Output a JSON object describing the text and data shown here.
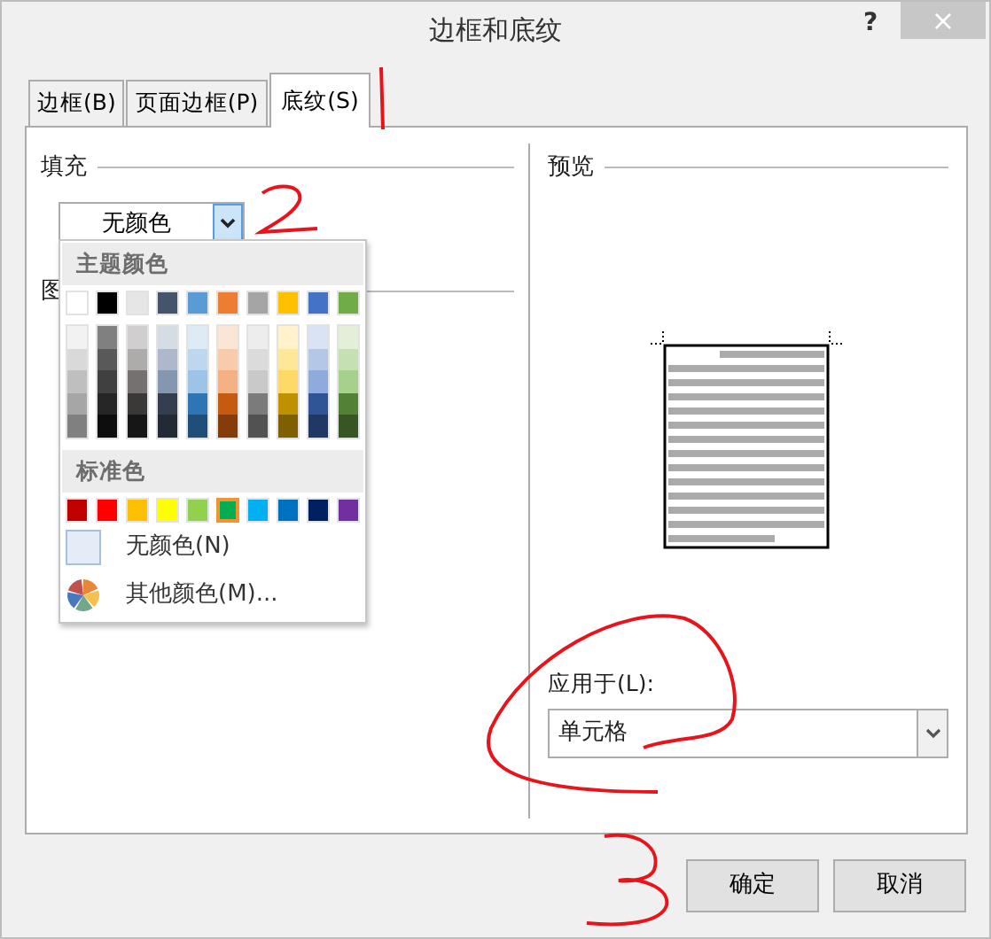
{
  "window": {
    "title": "边框和底纹",
    "help": "?",
    "close": "×"
  },
  "tabs": [
    {
      "label": "边框(B)",
      "selected": false
    },
    {
      "label": "页面边框(P)",
      "selected": false
    },
    {
      "label": "底纹(S)",
      "selected": true
    }
  ],
  "fill": {
    "label": "填充",
    "dropdown": {
      "value": "无颜色",
      "expanded": true
    }
  },
  "pattern": {
    "label": "图"
  },
  "color_menu": {
    "theme_header": "主题颜色",
    "theme_colors": [
      {
        "color": "#ffffff",
        "shades": [
          {
            "color": "#f2f2f2"
          },
          {
            "color": "#d9d9d9"
          },
          {
            "color": "#bfbfbf"
          },
          {
            "color": "#a6a6a6"
          },
          {
            "color": "#808080"
          }
        ]
      },
      {
        "color": "#000000",
        "shades": [
          {
            "color": "#808080"
          },
          {
            "color": "#595959"
          },
          {
            "color": "#404040"
          },
          {
            "color": "#262626"
          },
          {
            "color": "#0d0d0d"
          }
        ]
      },
      {
        "color": "#e7e6e6",
        "shades": [
          {
            "color": "#d0cece"
          },
          {
            "color": "#aeabab"
          },
          {
            "color": "#757171"
          },
          {
            "color": "#3b3838"
          },
          {
            "color": "#171616"
          }
        ]
      },
      {
        "color": "#44546a",
        "shades": [
          {
            "color": "#d6dce4"
          },
          {
            "color": "#adb9ca"
          },
          {
            "color": "#8496b0"
          },
          {
            "color": "#333f4f"
          },
          {
            "color": "#222a35"
          }
        ]
      },
      {
        "color": "#5b9bd5",
        "shades": [
          {
            "color": "#deebf6"
          },
          {
            "color": "#bdd7ee"
          },
          {
            "color": "#9dc3e6"
          },
          {
            "color": "#2e75b5"
          },
          {
            "color": "#1f4e79"
          }
        ]
      },
      {
        "color": "#ed7d31",
        "shades": [
          {
            "color": "#fbe5d5"
          },
          {
            "color": "#f7cbac"
          },
          {
            "color": "#f4b183"
          },
          {
            "color": "#c55a11"
          },
          {
            "color": "#843c0b"
          }
        ]
      },
      {
        "color": "#a5a5a5",
        "shades": [
          {
            "color": "#ededed"
          },
          {
            "color": "#dbdbdb"
          },
          {
            "color": "#c9c9c9"
          },
          {
            "color": "#7b7b7b"
          },
          {
            "color": "#525252"
          }
        ]
      },
      {
        "color": "#ffc000",
        "shades": [
          {
            "color": "#fff2cc"
          },
          {
            "color": "#ffe699"
          },
          {
            "color": "#ffd966"
          },
          {
            "color": "#bf9000"
          },
          {
            "color": "#7f6000"
          }
        ]
      },
      {
        "color": "#4472c4",
        "shades": [
          {
            "color": "#dae3f3"
          },
          {
            "color": "#b4c7e7"
          },
          {
            "color": "#8faadc"
          },
          {
            "color": "#2f5597"
          },
          {
            "color": "#1f3864"
          }
        ]
      },
      {
        "color": "#70ad47",
        "shades": [
          {
            "color": "#e2efd9"
          },
          {
            "color": "#c5e0b3"
          },
          {
            "color": "#a8d08d"
          },
          {
            "color": "#538135"
          },
          {
            "color": "#375623"
          }
        ]
      }
    ],
    "standard_header": "标准色",
    "standard_colors": [
      {
        "color": "#c00000",
        "selected": false
      },
      {
        "color": "#ff0000",
        "selected": false
      },
      {
        "color": "#ffc000",
        "selected": false
      },
      {
        "color": "#ffff00",
        "selected": false
      },
      {
        "color": "#92d050",
        "selected": false
      },
      {
        "color": "#00b050",
        "selected": true
      },
      {
        "color": "#00b0f0",
        "selected": false
      },
      {
        "color": "#0070c0",
        "selected": false
      },
      {
        "color": "#002060",
        "selected": false
      },
      {
        "color": "#7030a0",
        "selected": false
      }
    ],
    "no_color": "无颜色(N)",
    "more_colors": "其他颜色(M)..."
  },
  "preview": {
    "label": "预览"
  },
  "apply_to": {
    "label": "应用于(L):",
    "value": "单元格"
  },
  "buttons": [
    {
      "label": "确定"
    },
    {
      "label": "取消"
    }
  ]
}
